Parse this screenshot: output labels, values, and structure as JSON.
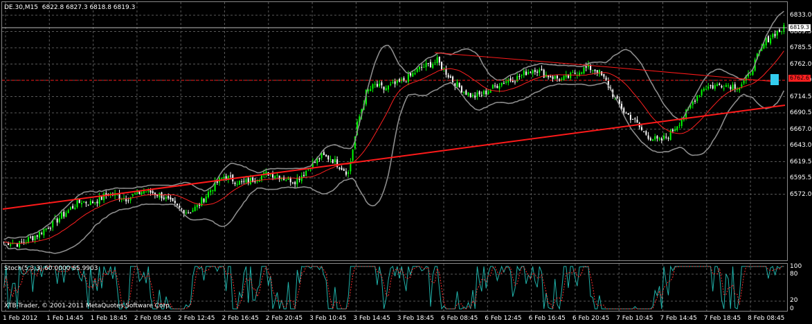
{
  "header": {
    "symbol": "DE.30,M15",
    "ohlc": "6822.8 6827.3 6818.8 6819.3"
  },
  "current_price_tag": "6819.3",
  "alert_price_tag": "6762.6",
  "stoch_header": "Stoch(5,3,3) 60.0000 65.9903",
  "copyright": "XTB-Trader, © 2001-2011 MetaQuotes Software Corp.",
  "colors": {
    "bull_candle": "#00ff00",
    "bear_candle": "#ffffff",
    "trendline": "#ff1a1a",
    "bollinger": "#8c8c8c",
    "moving_average": "#ff2020",
    "stoch_main": "#20b2aa",
    "stoch_signal": "#ff3030",
    "grid": "#5a5a5a",
    "alert_tag_bg": "#ff2020",
    "current_tag_bg": "#ffffff"
  },
  "price_axis": [
    "6833.0",
    "6809.5",
    "6785.5",
    "6762.0",
    "6738.0",
    "6714.5",
    "6690.5",
    "6667.0",
    "6643.0",
    "6619.5",
    "6595.5",
    "6572.0"
  ],
  "stoch_axis": [
    "100",
    "80",
    "20",
    "0"
  ],
  "time_axis": [
    "1 Feb 2012",
    "1 Feb 14:45",
    "1 Feb 18:45",
    "2 Feb 08:45",
    "2 Feb 12:45",
    "2 Feb 16:45",
    "2 Feb 20:45",
    "3 Feb 10:45",
    "3 Feb 14:45",
    "3 Feb 18:45",
    "6 Feb 08:45",
    "6 Feb 12:45",
    "6 Feb 16:45",
    "6 Feb 20:45",
    "7 Feb 10:45",
    "7 Feb 14:45",
    "7 Feb 18:45",
    "8 Feb 08:45"
  ],
  "chart_data": {
    "type": "candlestick",
    "symbol": "DE.30",
    "timeframe": "M15",
    "ylim": [
      6572.0,
      6845.0
    ],
    "stoch_ylim": [
      0,
      100
    ],
    "series": [
      {
        "name": "close",
        "values": [
          6590,
          6588,
          6593,
          6598,
          6605,
          6612,
          6620,
          6628,
          6634,
          6632,
          6636,
          6642,
          6640,
          6637,
          6641,
          6645,
          6643,
          6640,
          6632,
          6626,
          6622,
          6628,
          6640,
          6652,
          6660,
          6657,
          6653,
          6656,
          6660,
          6664,
          6662,
          6658,
          6656,
          6664,
          6674,
          6682,
          6680,
          6672,
          6664,
          6716,
          6750,
          6758,
          6754,
          6758,
          6762,
          6768,
          6776,
          6780,
          6784,
          6772,
          6760,
          6752,
          6746,
          6748,
          6754,
          6760,
          6764,
          6766,
          6772,
          6776,
          6770,
          6767,
          6764,
          6768,
          6774,
          6777,
          6774,
          6762,
          6744,
          6730,
          6722,
          6710,
          6702,
          6698,
          6704,
          6716,
          6728,
          6744,
          6756,
          6757,
          6759,
          6758,
          6757,
          6768,
          6788,
          6806,
          6814,
          6819
        ]
      }
    ]
  }
}
